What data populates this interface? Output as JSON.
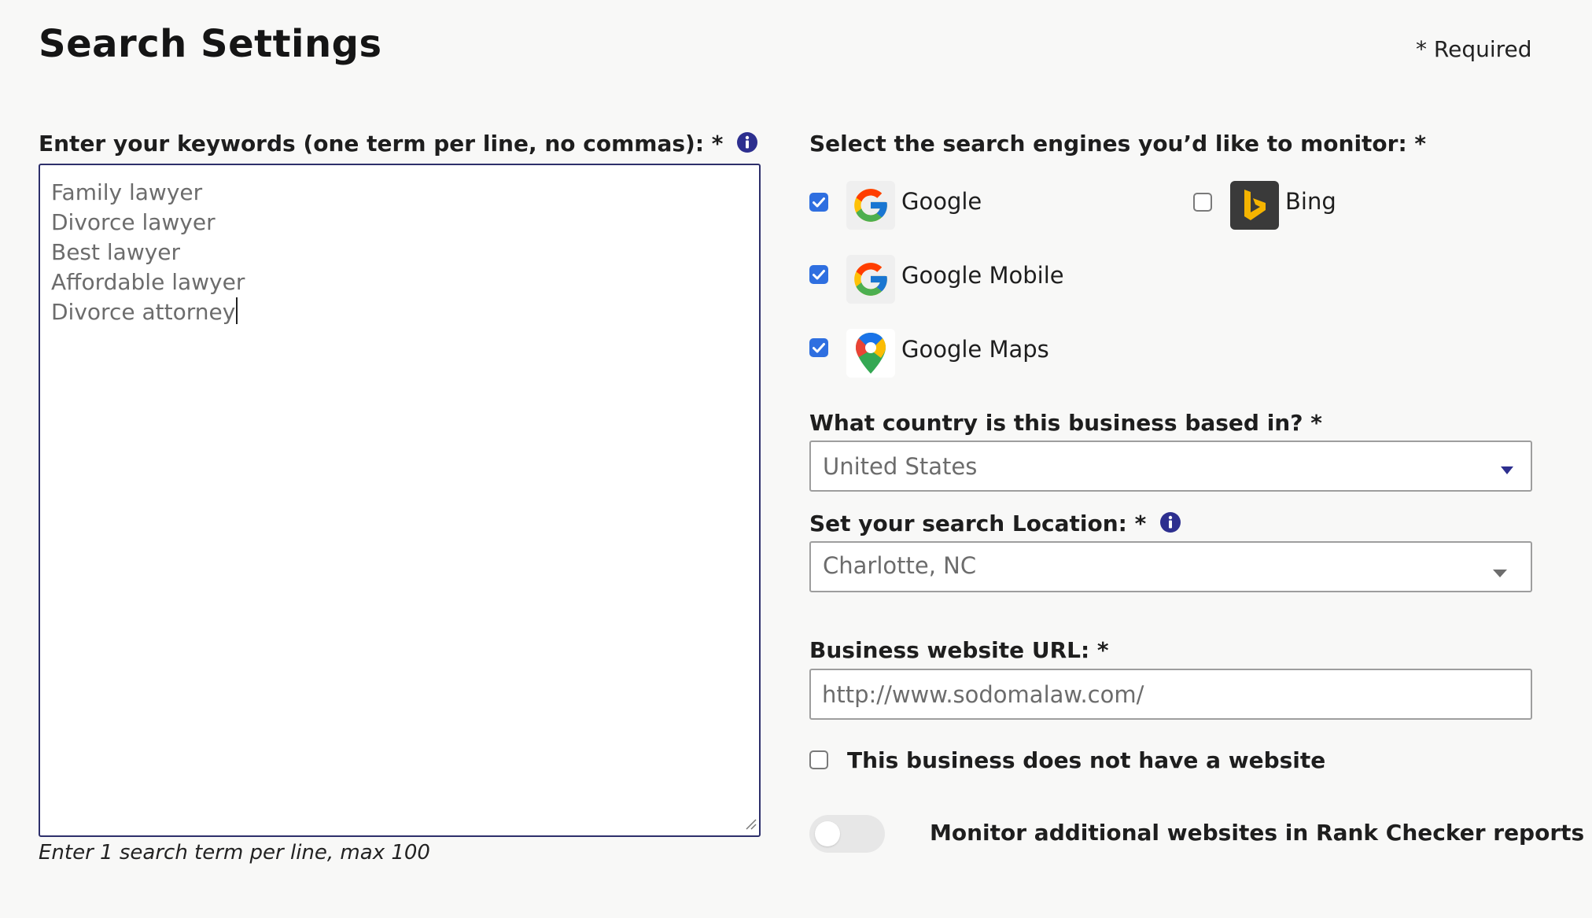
{
  "header": {
    "title": "Search Settings",
    "required_note": "* Required"
  },
  "keywords": {
    "label": "Enter your keywords (one term per line, no commas): *",
    "lines": [
      "Family lawyer",
      "Divorce lawyer",
      "Best lawyer",
      "Affordable lawyer",
      "Divorce attorney"
    ],
    "hint": "Enter 1 search term per line, max 100"
  },
  "engines": {
    "label": "Select the search engines you’d like to monitor: *",
    "items": [
      {
        "label": "Google",
        "checked": true
      },
      {
        "label": "Bing",
        "checked": false
      },
      {
        "label": "Google Mobile",
        "checked": true
      },
      {
        "label": "Google Maps",
        "checked": true
      }
    ]
  },
  "country": {
    "label": "What country is this business based in? *",
    "value": "United States"
  },
  "location": {
    "label": "Set your search Location: *",
    "value": "Charlotte, NC"
  },
  "website": {
    "label": "Business website URL: *",
    "value": "http://www.sodomalaw.com/"
  },
  "no_website": {
    "label": "This business does not have a website",
    "checked": false
  },
  "monitor_additional": {
    "label": "Monitor additional websites in Rank Checker reports",
    "enabled": false
  },
  "colors": {
    "accent": "#2f6fe0",
    "info_icon": "#2d2f8f",
    "textarea_border": "#2d2f6b"
  }
}
